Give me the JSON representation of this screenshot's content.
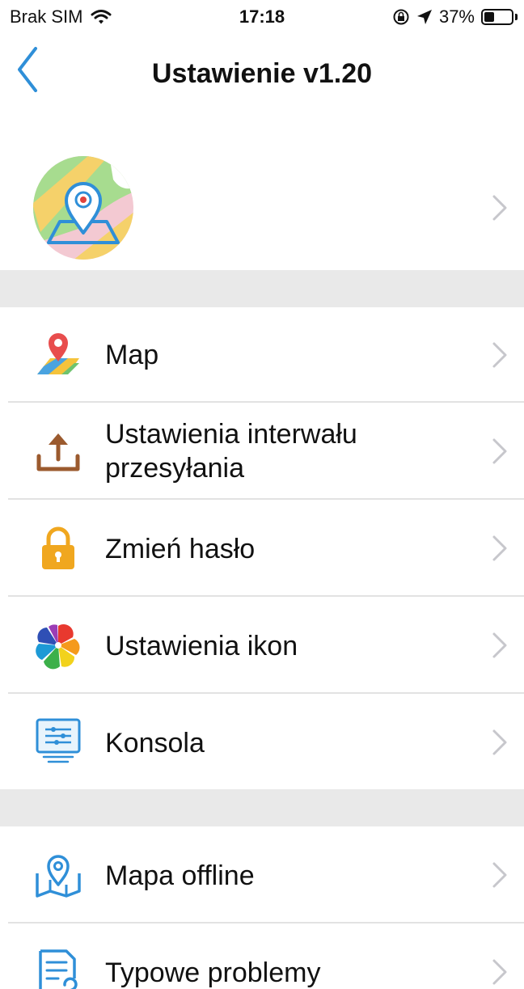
{
  "status_bar": {
    "carrier": "Brak SIM",
    "time": "17:18",
    "battery_percent": "37%",
    "battery_level": 0.37
  },
  "nav": {
    "title": "Ustawienie v1.20",
    "back_icon": "chevron-left-icon"
  },
  "profile": {
    "avatar_icon": "map-pin-avatar-icon"
  },
  "menu_group_1": [
    {
      "label": "Map",
      "icon": "map-icon"
    },
    {
      "label": "Ustawienia interwału przesyłania",
      "icon": "upload-icon"
    },
    {
      "label": "Zmień hasło",
      "icon": "lock-icon"
    },
    {
      "label": "Ustawienia ikon",
      "icon": "pinwheel-icon"
    },
    {
      "label": "Konsola",
      "icon": "console-icon"
    }
  ],
  "menu_group_2": [
    {
      "label": "Mapa offline",
      "icon": "offline-map-icon"
    },
    {
      "label": "Typowe problemy",
      "icon": "faq-document-icon"
    }
  ],
  "colors": {
    "accent": "#2f8fd8",
    "separator": "#e9e9e9",
    "chevron": "#c7c7cc"
  }
}
